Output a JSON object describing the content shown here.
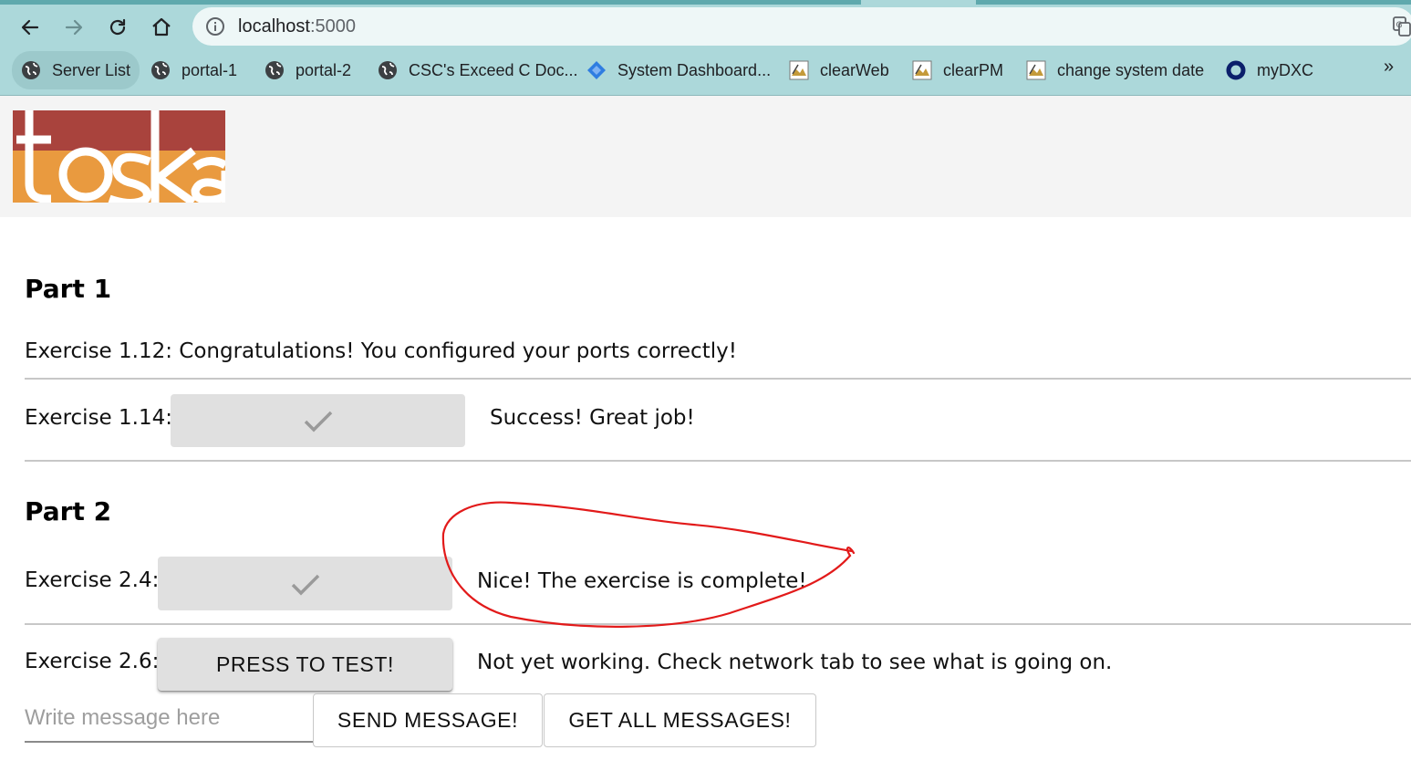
{
  "browser": {
    "url_host": "localhost",
    "url_port": ":5000",
    "bookmarks": [
      {
        "label": "Server List",
        "icon": "globe-icon"
      },
      {
        "label": "portal-1",
        "icon": "globe-icon"
      },
      {
        "label": "portal-2",
        "icon": "globe-icon"
      },
      {
        "label": "CSC's Exceed C Doc...",
        "icon": "globe-icon"
      },
      {
        "label": "System Dashboard...",
        "icon": "diamond-icon"
      },
      {
        "label": "clearWeb",
        "icon": "clearcase-icon"
      },
      {
        "label": "clearPM",
        "icon": "clearcase-icon"
      },
      {
        "label": "change system date",
        "icon": "clearcase-icon"
      },
      {
        "label": "myDXC",
        "icon": "ring-icon"
      }
    ],
    "more_label": "»"
  },
  "colors": {
    "logo_top": "#a9433d",
    "logo_bottom": "#e99a3f",
    "annotation": "#e21a1a"
  },
  "part1": {
    "heading": "Part 1",
    "ex112_text": "Exercise 1.12: Congratulations! You configured your ports correctly!",
    "ex114_label": "Exercise 1.14:",
    "ex114_status": "Success! Great job!"
  },
  "part2": {
    "heading": "Part 2",
    "ex24_label": "Exercise 2.4:",
    "ex24_status": "Nice! The exercise is complete!",
    "ex26_label": "Exercise 2.6:",
    "ex26_button": "PRESS TO TEST!",
    "ex26_status": "Not yet working. Check network tab to see what is going on."
  },
  "messages": {
    "input_placeholder": "Write message here",
    "input_value": "",
    "send_button": "SEND MESSAGE!",
    "get_all_button": "GET ALL MESSAGES!"
  }
}
